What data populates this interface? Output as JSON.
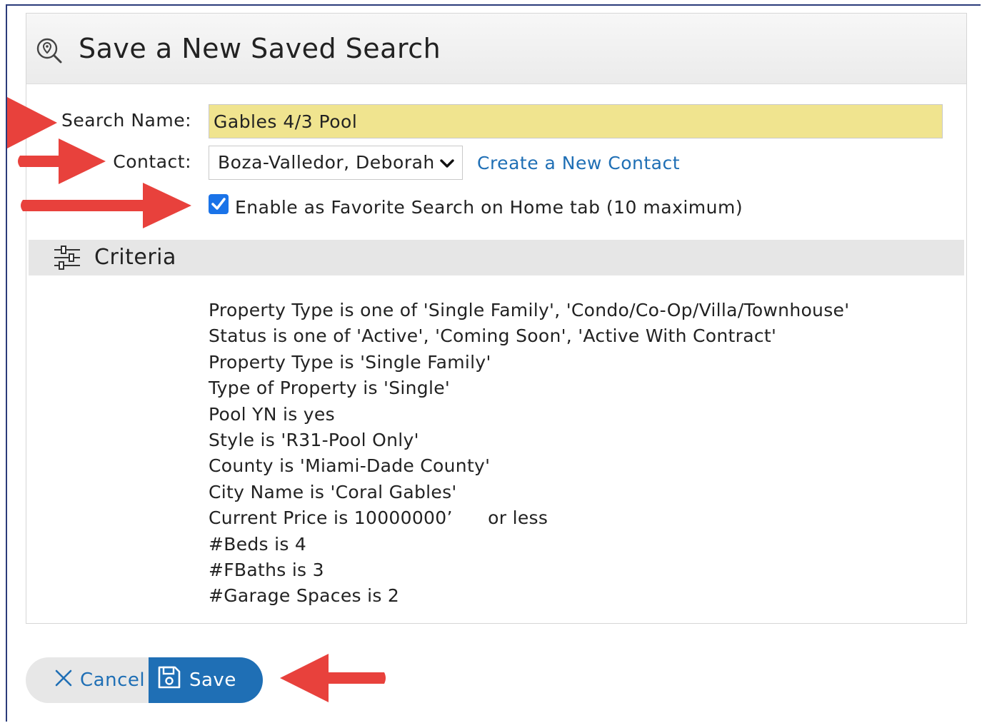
{
  "dialog": {
    "title": "Save a New Saved Search",
    "title_icon": "search-pin-icon"
  },
  "form": {
    "search_name_label": "Search Name:",
    "search_name_value": "Gables 4/3 Pool",
    "contact_label": "Contact:",
    "contact_selected": "Boza-Valledor, Deborah",
    "create_contact_link": "Create a New Contact",
    "favorite_checkbox_label": "Enable as Favorite Search on Home tab (10 maximum)",
    "favorite_checked": true
  },
  "criteria": {
    "title": "Criteria",
    "icon": "sliders-icon",
    "items": [
      "Property Type is one of 'Single Family', 'Condo/Co-Op/Villa/Townhouse'",
      "Status is one of 'Active', 'Coming Soon', 'Active With Contract'",
      "Property Type is 'Single Family'",
      "Type of Property is 'Single'",
      "Pool YN is yes",
      "Style is 'R31-Pool Only'",
      "County is 'Miami-Dade County'",
      "City Name is 'Coral Gables'",
      "Current Price is 10000000’      or less",
      "#Beds is 4",
      "#FBaths is 3",
      "#Garage Spaces is 2"
    ]
  },
  "buttons": {
    "cancel_label": "Cancel",
    "save_label": "Save"
  },
  "colors": {
    "accent_blue": "#1f6fb5",
    "input_highlight": "#f0e48f",
    "checkbox_blue": "#1a73e8",
    "annotation_arrow": "#e8413c"
  }
}
